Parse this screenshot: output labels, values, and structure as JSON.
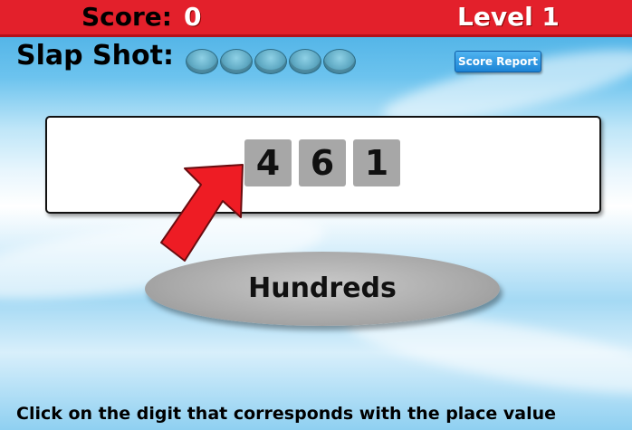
{
  "header": {
    "score_label": "Score:",
    "score_value": "0",
    "level_label": "Level 1"
  },
  "slap_shot": {
    "label": "Slap Shot:",
    "pucks_remaining": 5
  },
  "score_report": {
    "label": "Score Report"
  },
  "number": {
    "digits": [
      "4",
      "6",
      "1"
    ]
  },
  "place_value": {
    "label": "Hundreds"
  },
  "instructions": "Click on the digit that corresponds with the place value",
  "colors": {
    "header_red": "#e3202b",
    "digit_tile": "#a7a7a7",
    "arrow_red": "#ee1c24",
    "button_blue": "#1c84d6"
  }
}
